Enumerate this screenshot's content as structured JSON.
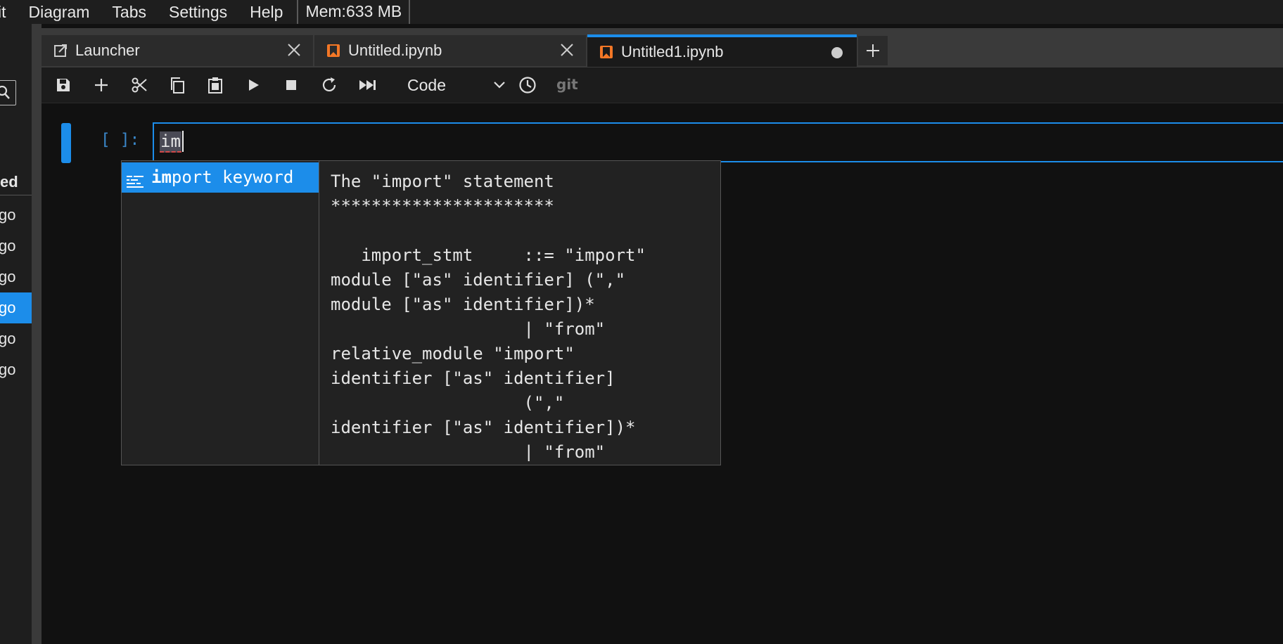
{
  "menubar": {
    "items": [
      "it",
      "Diagram",
      "Tabs",
      "Settings",
      "Help"
    ],
    "memory": "Mem:633 MB"
  },
  "sidebar": {
    "header": "ed",
    "rows": [
      "go",
      "go",
      "go",
      "go",
      "go",
      "go"
    ],
    "selected_index": 3
  },
  "tabs": [
    {
      "label": "Launcher",
      "icon": "launcher-icon",
      "active": false,
      "dirty": false
    },
    {
      "label": "Untitled.ipynb",
      "icon": "notebook-icon",
      "active": false,
      "dirty": false
    },
    {
      "label": "Untitled1.ipynb",
      "icon": "notebook-icon",
      "active": true,
      "dirty": true
    }
  ],
  "toolbar": {
    "cell_type": "Code",
    "git_label": "git"
  },
  "cell": {
    "prompt": "[ ]:",
    "source": "im"
  },
  "completer": {
    "item": {
      "match": "im",
      "rest": "port keyword"
    },
    "doc_lines": [
      "The \"import\" statement",
      "**********************",
      "",
      "   import_stmt     ::= \"import\"",
      "module [\"as\" identifier] (\",\"",
      "module [\"as\" identifier])*",
      "                   | \"from\"",
      "relative_module \"import\"",
      "identifier [\"as\" identifier]",
      "                   (\",\"",
      "identifier [\"as\" identifier])*",
      "                   | \"from\""
    ]
  },
  "colors": {
    "accent": "#1c8dea",
    "notebook_icon": "#f37726",
    "background": "#111111"
  }
}
